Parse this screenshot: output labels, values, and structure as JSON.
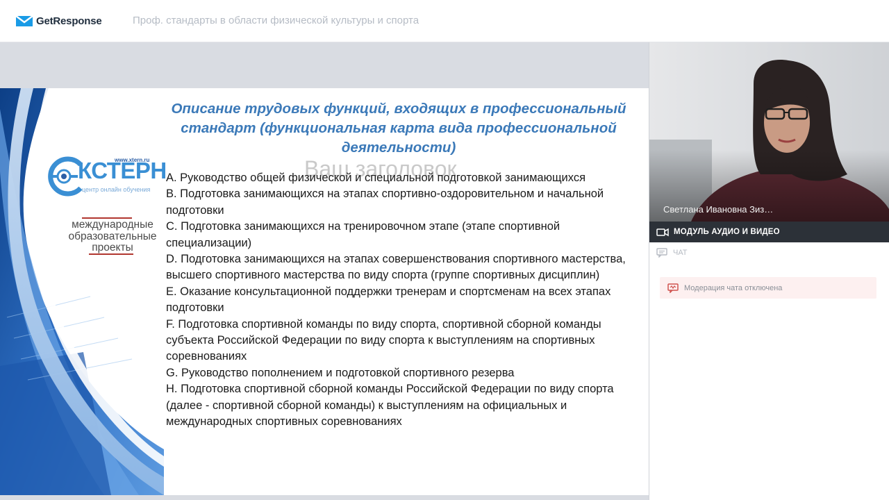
{
  "app": {
    "logo_text": "GetResponse",
    "webinar_title": "Проф. стандарты в области физической культуры и спорта"
  },
  "slide": {
    "title": "Описание трудовых функций, входящих в профессиональный стандарт (функциональная карта вида профессиональной деятельности)",
    "ghost_text": "Ваш заголовок",
    "brand": {
      "url": "www.xtern.ru",
      "name": "КСТЕРН",
      "tagline": "центр онлайн обучения",
      "program": "международные образовательные проекты"
    },
    "items": [
      "A. Руководство общей физической и специальной подготовкой занимающихся",
      "B. Подготовка занимающихся на этапах спортивно-оздоровительном и начальной подготовки",
      "C. Подготовка занимающихся на тренировочном этапе (этапе спортивной специализации)",
      "D. Подготовка занимающихся на этапах совершенствования спортивного мастерства, высшего спортивного мастерства по виду спорта (группе спортивных дисциплин)",
      "E. Оказание консультационной поддержки тренерам и спортсменам на всех этапах подготовки",
      "F. Подготовка спортивной команды по виду спорта, спортивной сборной команды субъекта Российской Федерации по виду спорта к выступлениям на спортивных соревнованиях",
      "G. Руководство пополнением и подготовкой спортивного резерва",
      "H. Подготовка спортивной сборной команды Российской Федерации по виду спорта (далее - спортивной сборной команды) к выступлениям на официальных и международных спортивных соревнованиях"
    ]
  },
  "video": {
    "speaker_name": "Светлана Ивановна Зиз…",
    "module_label": "МОДУЛЬ АУДИО И ВИДЕО"
  },
  "chat": {
    "label": "ЧАТ",
    "notice": "Модерация чата отключена"
  },
  "colors": {
    "brand_blue": "#1a9be6",
    "slide_title": "#3b79b8",
    "av_bar": "#2c3138",
    "notice_bg": "#fdf0f0",
    "notice_icon": "#d0534f"
  }
}
